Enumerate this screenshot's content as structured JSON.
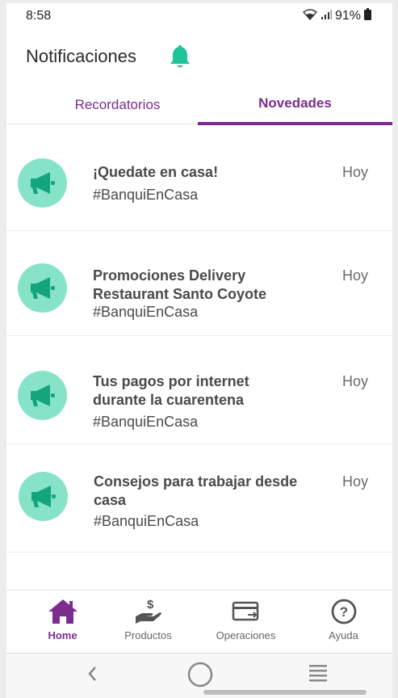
{
  "status_bar": {
    "time": "8:58",
    "battery": "91%"
  },
  "header": {
    "title": "Notificaciones",
    "icon": "bell-icon"
  },
  "tabs": [
    {
      "label": "Recordatorios",
      "active": false
    },
    {
      "label": "Novedades",
      "active": true
    }
  ],
  "notifications": [
    {
      "title": "¡Quedate en casa!",
      "subtitle": "#BanquiEnCasa",
      "date": "Hoy",
      "icon": "megaphone-icon"
    },
    {
      "title": "Promociones Delivery Restaurant Santo Coyote",
      "subtitle": "#BanquiEnCasa",
      "date": "Hoy",
      "icon": "megaphone-icon"
    },
    {
      "title": "Tus pagos por internet durante la cuarentena",
      "subtitle": "#BanquiEnCasa",
      "date": "Hoy",
      "icon": "megaphone-icon"
    },
    {
      "title": "Consejos para trabajar desde casa",
      "subtitle": "#BanquiEnCasa",
      "date": "Hoy",
      "icon": "megaphone-icon"
    }
  ],
  "bottom_nav": [
    {
      "label": "Home",
      "icon": "home-icon",
      "active": true
    },
    {
      "label": "Productos",
      "icon": "hand-money-icon",
      "active": false
    },
    {
      "label": "Operaciones",
      "icon": "card-transfer-icon",
      "active": false
    },
    {
      "label": "Ayuda",
      "icon": "help-icon",
      "active": false
    }
  ],
  "colors": {
    "accent": "#7b2c8e",
    "mint": "#86e3c8",
    "icon_dark": "#14a57f",
    "bell": "#1fc49a"
  }
}
